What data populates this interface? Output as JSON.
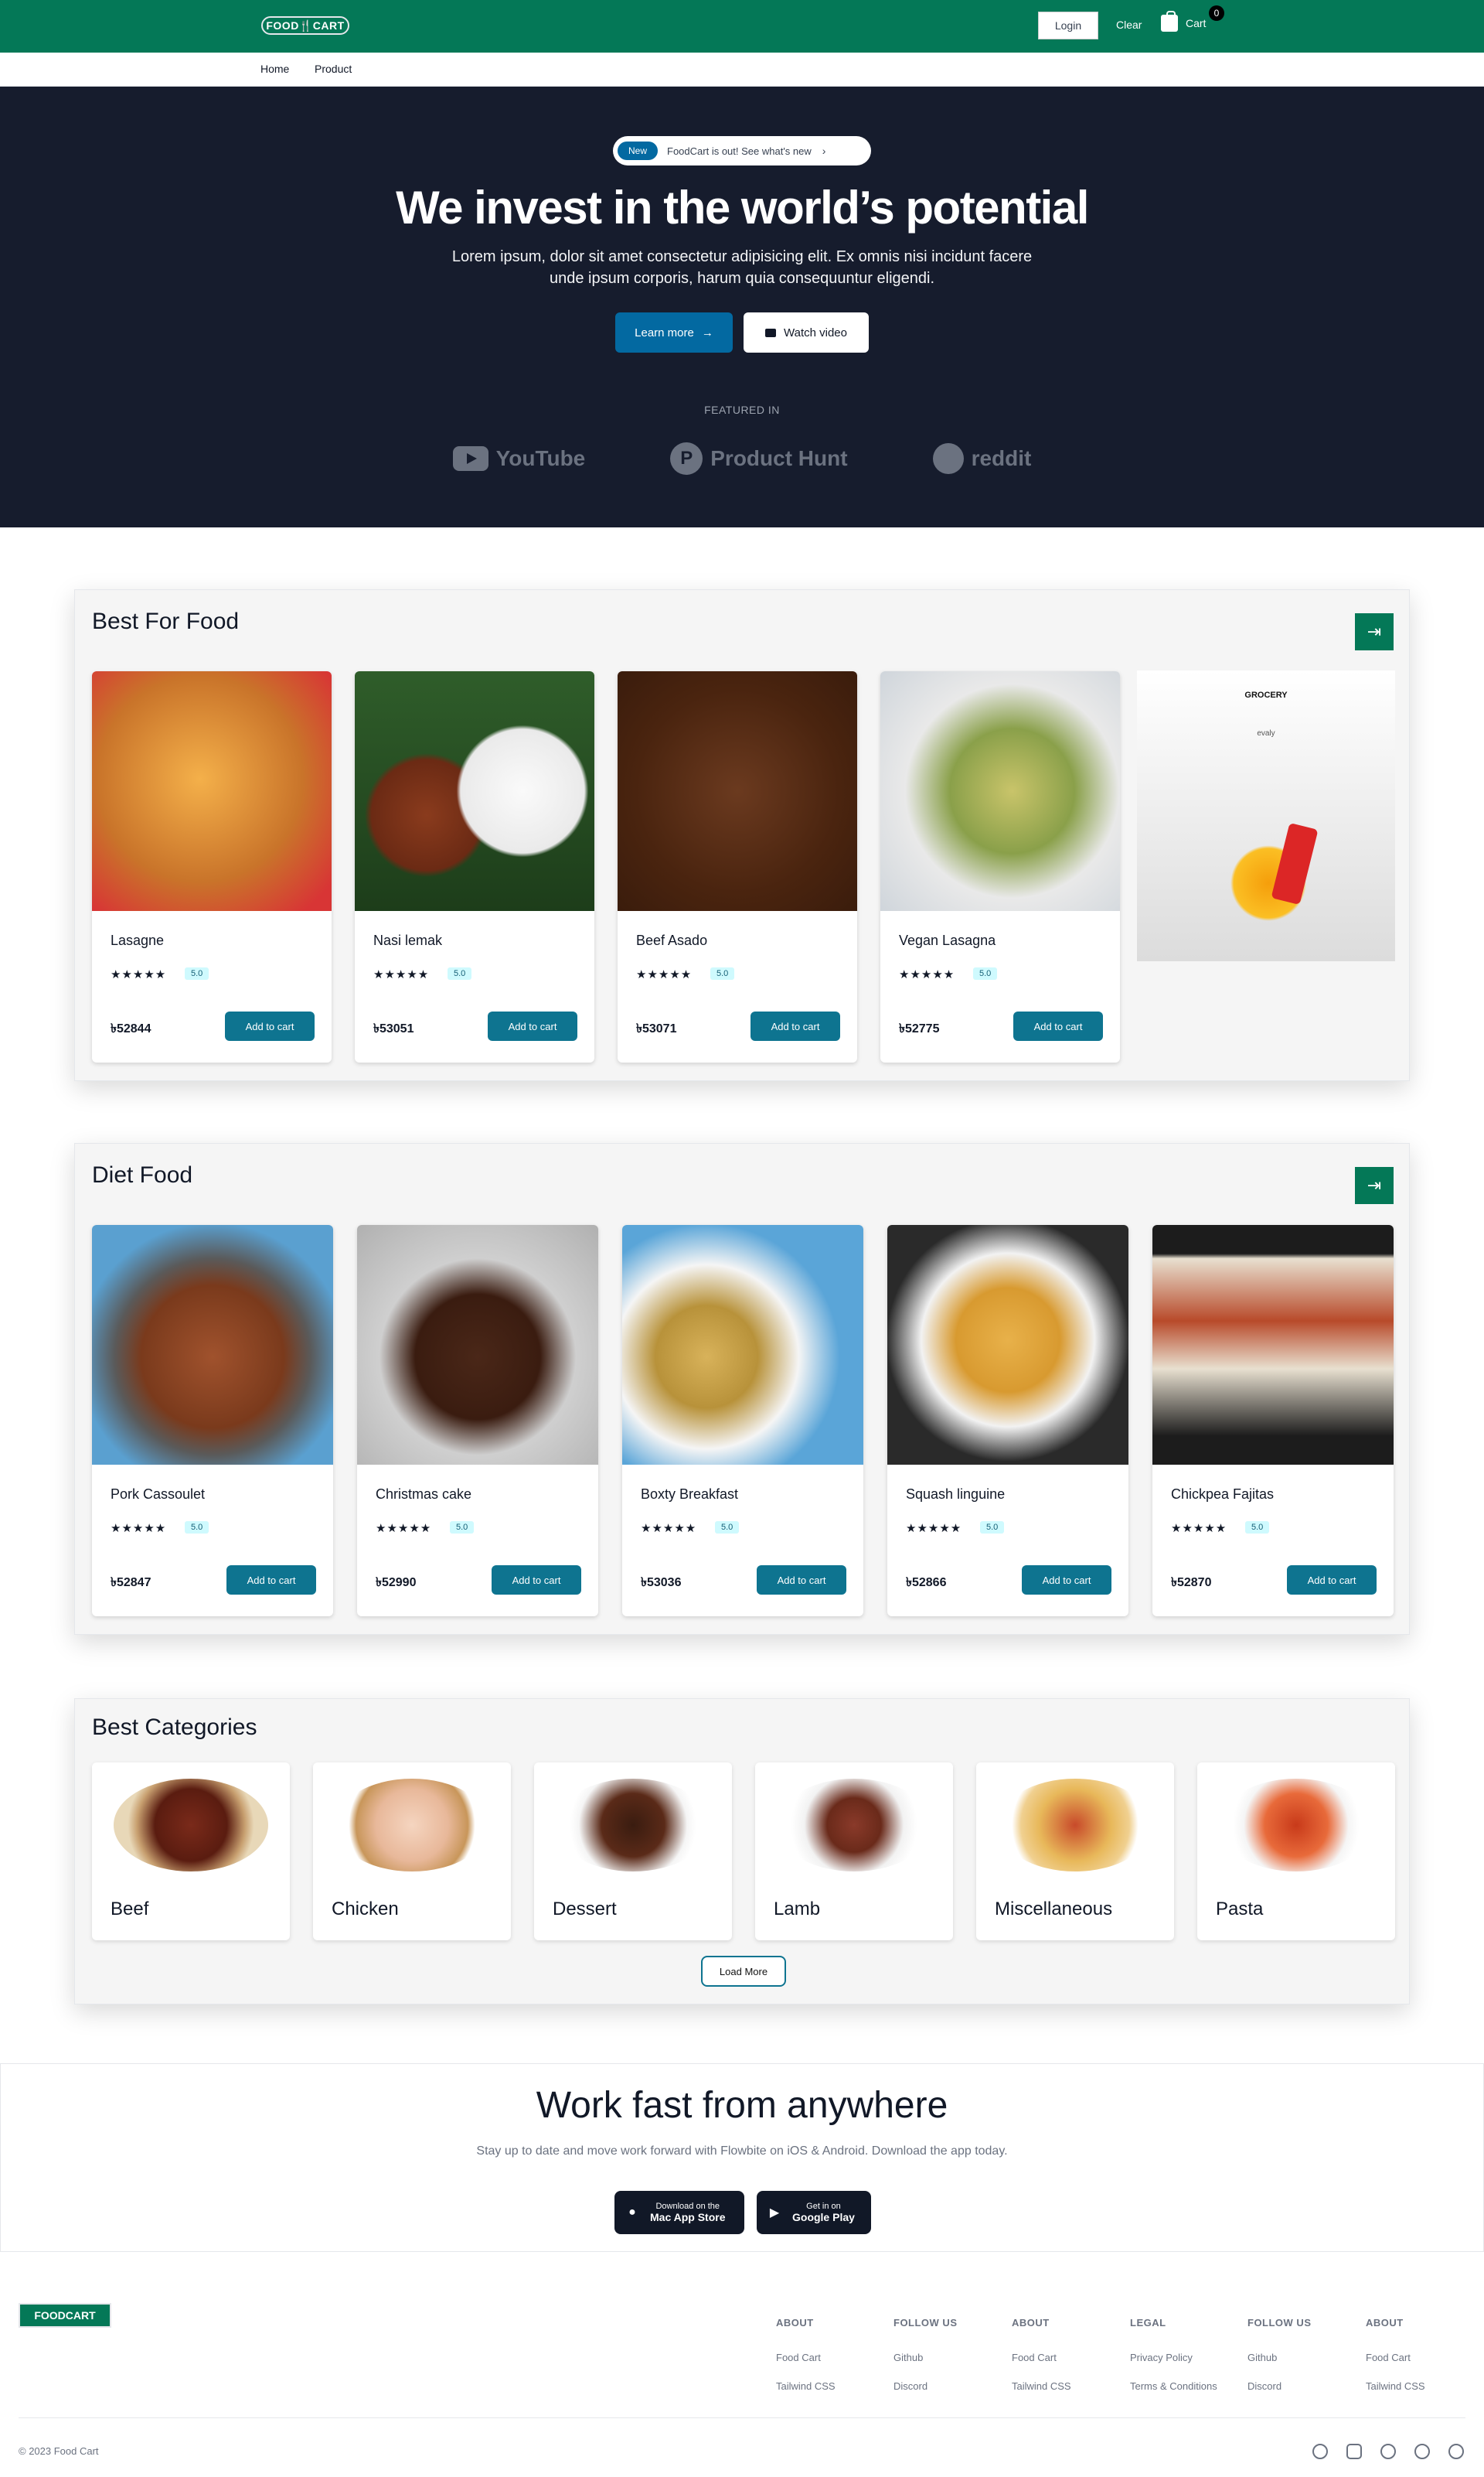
{
  "header": {
    "logo_left": "FOOD",
    "logo_mid": "🍴",
    "logo_right": "CART",
    "login": "Login",
    "clear": "Clear",
    "cart": "Cart",
    "cart_count": "0"
  },
  "subnav": {
    "home": "Home",
    "product": "Product"
  },
  "hero": {
    "pill_badge": "New",
    "pill_text": "FoodCart is out! See what's new",
    "title": "We invest in the world’s potential",
    "subtitle": "Lorem ipsum, dolor sit amet consectetur adipisicing elit. Ex omnis nisi incidunt facere unde ipsum corporis, harum quia consequuntur eligendi.",
    "learn_more": "Learn more",
    "watch_video": "Watch video",
    "featured": "FEATURED IN",
    "brands": [
      "YouTube",
      "Product Hunt",
      "reddit"
    ]
  },
  "best_food": {
    "title": "Best For Food",
    "items": [
      {
        "name": "Lasagne",
        "rating": "5.0",
        "price": "৳52844",
        "add": "Add to cart"
      },
      {
        "name": "Nasi lemak",
        "rating": "5.0",
        "price": "৳53051",
        "add": "Add to cart"
      },
      {
        "name": "Beef Asado",
        "rating": "5.0",
        "price": "৳53071",
        "add": "Add to cart"
      },
      {
        "name": "Vegan Lasagna",
        "rating": "5.0",
        "price": "৳52775",
        "add": "Add to cart"
      }
    ],
    "ad_heading": "GROCERY",
    "ad_brand": "evaly"
  },
  "diet_food": {
    "title": "Diet Food",
    "items": [
      {
        "name": "Pork Cassoulet",
        "rating": "5.0",
        "price": "৳52847",
        "add": "Add to cart"
      },
      {
        "name": "Christmas cake",
        "rating": "5.0",
        "price": "৳52990",
        "add": "Add to cart"
      },
      {
        "name": "Boxty Breakfast",
        "rating": "5.0",
        "price": "৳53036",
        "add": "Add to cart"
      },
      {
        "name": "Squash linguine",
        "rating": "5.0",
        "price": "৳52866",
        "add": "Add to cart"
      },
      {
        "name": "Chickpea Fajitas",
        "rating": "5.0",
        "price": "৳52870",
        "add": "Add to cart"
      }
    ]
  },
  "categories": {
    "title": "Best Categories",
    "items": [
      "Beef",
      "Chicken",
      "Dessert",
      "Lamb",
      "Miscellaneous",
      "Pasta"
    ],
    "load_more": "Load More"
  },
  "app": {
    "title": "Work fast from anywhere",
    "subtitle": "Stay up to date and move work forward with Flowbite on iOS & Android. Download the app today.",
    "apple_l1": "Download on the",
    "apple_l2": "Mac App Store",
    "google_l1": "Get in on",
    "google_l2": "Google Play"
  },
  "footer": {
    "logo": "FOODCART",
    "columns": [
      {
        "heading": "ABOUT",
        "links": [
          "Food Cart",
          "Tailwind CSS"
        ]
      },
      {
        "heading": "FOLLOW US",
        "links": [
          "Github",
          "Discord"
        ]
      },
      {
        "heading": "ABOUT",
        "links": [
          "Food Cart",
          "Tailwind CSS"
        ]
      },
      {
        "heading": "LEGAL",
        "links": [
          "Privacy Policy",
          "Terms & Conditions"
        ]
      },
      {
        "heading": "FOLLOW US",
        "links": [
          "Github",
          "Discord"
        ]
      },
      {
        "heading": "ABOUT",
        "links": [
          "Food Cart",
          "Tailwind CSS"
        ]
      }
    ],
    "copyright": "© 2023 Food Cart",
    "social_icons": [
      "facebook-icon",
      "instagram-icon",
      "twitter-icon",
      "github-icon",
      "dribbble-icon"
    ]
  },
  "colors": {
    "brand_green": "#047857",
    "hero_bg": "#161c2d",
    "button_teal": "#0e7490",
    "accent_blue": "#0369a1"
  }
}
